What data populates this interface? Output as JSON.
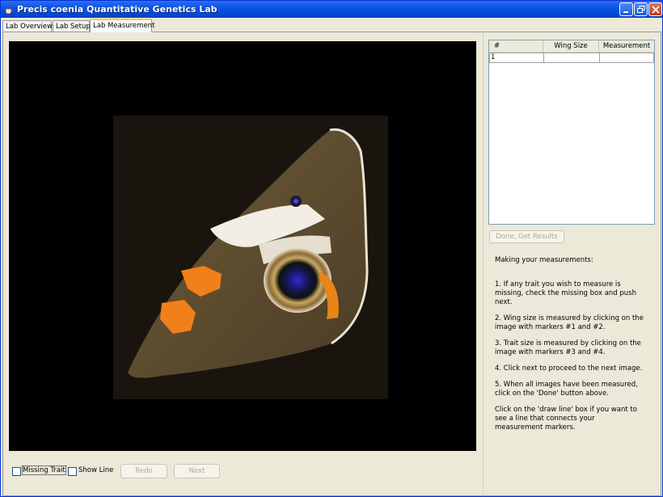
{
  "window": {
    "title": "Precis coenia Quantitative Genetics Lab"
  },
  "tabs": [
    {
      "label": "Lab Overview"
    },
    {
      "label": "Lab Setup"
    },
    {
      "label": "Lab Measurement",
      "active": true
    }
  ],
  "bottom_bar": {
    "missing_trait_label": "Missing Trait",
    "missing_trait_checked": false,
    "show_line_label": "Show Line",
    "show_line_checked": false,
    "redo_label": "Redo",
    "next_label": "Next"
  },
  "table": {
    "columns": [
      "#",
      "Wing Size",
      "Measurement"
    ],
    "rows": [
      {
        "num": "1",
        "wing_size": "",
        "measurement": ""
      }
    ]
  },
  "done_button_label": "Done, Get Results",
  "instructions": [
    "Making your measurements:",
    "1. If any trait you wish to measure is missing, check the missing box and push next.",
    "2. Wing size is measured by clicking on the image with markers #1 and #2.",
    "3. Trait size is measured by clicking on the image with markers #3 and #4.",
    "4. Click next to proceed to the next image.",
    "5. When all images have been measured, click on the 'Done' button above.",
    "Click on the 'draw line' box if you want to see a line that connects your measurement markers."
  ],
  "icons": {
    "app": "java-cup-icon",
    "minimize": "minimize-icon",
    "maximize": "restore-icon",
    "close": "close-icon"
  },
  "colors": {
    "titlebar": "#0a55e6",
    "tab_highlight": "#ffc83c",
    "image_background": "#000000",
    "close_button": "#c2351a"
  }
}
